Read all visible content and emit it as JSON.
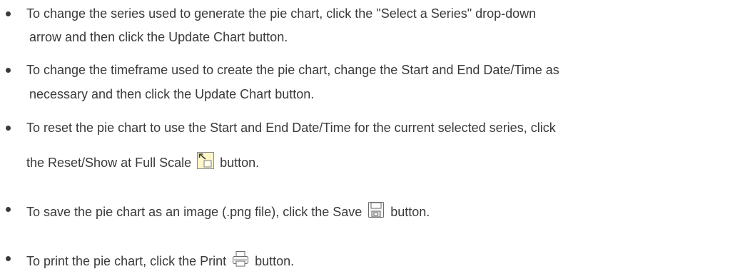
{
  "bullets": [
    {
      "line1": "To change the series used to generate the pie chart, click the \"Select a Series\" drop-down",
      "line2": "arrow and then click the Update Chart button."
    },
    {
      "line1": "To change the timeframe used to create the pie chart, change the Start and End Date/Time as",
      "line2": "necessary and then click the Update Chart button."
    },
    {
      "line1": "To reset the pie chart to use the Start and End Date/Time for the current selected series, click",
      "line2_before": "the Reset/Show at Full Scale",
      "icon": "reset-full-scale-icon",
      "line2_after": "button."
    },
    {
      "text_before": "To save the pie chart as an image (.png file), click the Save",
      "icon": "save-icon",
      "text_after": "button."
    },
    {
      "text_before": "To print the pie chart, click the Print",
      "icon": "print-icon",
      "text_after": "button."
    }
  ],
  "colors": {
    "text": "#3a3a3a",
    "icon_fill": "#fff7c8",
    "icon_stroke": "#8a8a8a",
    "icon_arrow": "#3c3c3c"
  }
}
